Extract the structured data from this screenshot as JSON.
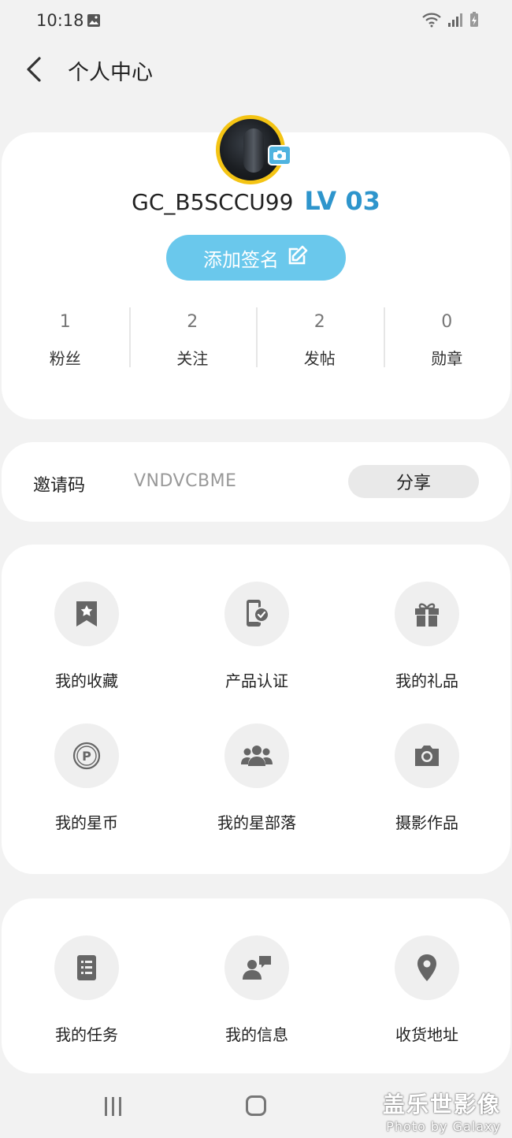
{
  "status_bar": {
    "time": "10:18"
  },
  "header": {
    "title": "个人中心"
  },
  "profile": {
    "username": "GC_B5SCCU99",
    "level": "LV 03",
    "signature_button": "添加签名",
    "stats": [
      {
        "value": "1",
        "label": "粉丝"
      },
      {
        "value": "2",
        "label": "关注"
      },
      {
        "value": "2",
        "label": "发帖"
      },
      {
        "value": "0",
        "label": "勋章"
      }
    ]
  },
  "invite": {
    "label": "邀请码",
    "code": "VNDVCBME",
    "share_button": "分享"
  },
  "menu_1": [
    {
      "label": "我的收藏",
      "icon": "bookmark-star-icon"
    },
    {
      "label": "产品认证",
      "icon": "phone-verified-icon"
    },
    {
      "label": "我的礼品",
      "icon": "gift-icon"
    },
    {
      "label": "我的星币",
      "icon": "coin-p-icon"
    },
    {
      "label": "我的星部落",
      "icon": "group-icon"
    },
    {
      "label": "摄影作品",
      "icon": "camera-icon"
    }
  ],
  "menu_2": [
    {
      "label": "我的任务",
      "icon": "task-list-icon"
    },
    {
      "label": "我的信息",
      "icon": "message-user-icon"
    },
    {
      "label": "收货地址",
      "icon": "location-pin-icon"
    }
  ],
  "watermark": {
    "title": "盖乐世影像",
    "subtitle": "Photo by Galaxy"
  },
  "colors": {
    "accent": "#2e95cc",
    "signature_button": "#6ac8ec",
    "avatar_border": "#f4c414",
    "icon_gray": "#666666"
  }
}
